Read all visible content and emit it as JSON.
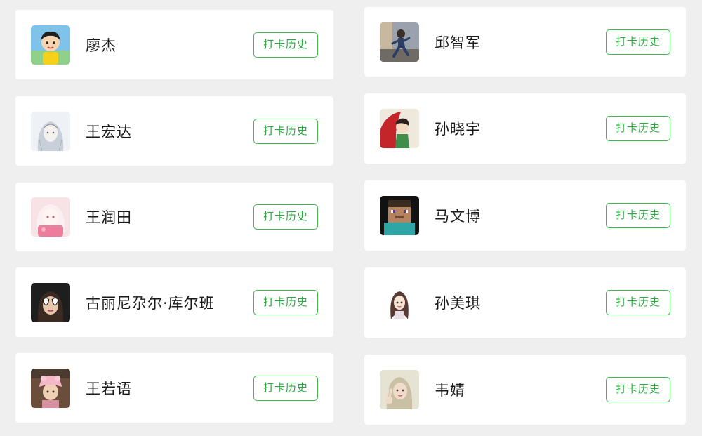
{
  "button_label": "打卡历史",
  "colors": {
    "background": "#efefef",
    "card": "#ffffff",
    "accent_border": "#3dbb4e",
    "accent_text": "#2fa844"
  },
  "members": [
    {
      "name": "廖杰",
      "avatar_icon": "cartoon-boy-avatar-icon"
    },
    {
      "name": "邱智军",
      "avatar_icon": "running-child-avatar-icon"
    },
    {
      "name": "王宏达",
      "avatar_icon": "sketch-girl-avatar-icon"
    },
    {
      "name": "孙晓宇",
      "avatar_icon": "red-umbrella-girl-avatar-icon"
    },
    {
      "name": "王润田",
      "avatar_icon": "pink-anime-girl-avatar-icon"
    },
    {
      "name": "马文博",
      "avatar_icon": "minecraft-steve-avatar-icon"
    },
    {
      "name": "古丽尼尕尔·库尔班",
      "avatar_icon": "heart-sunglasses-girl-avatar-icon"
    },
    {
      "name": "孙美琪",
      "avatar_icon": "cartoon-girl-long-hair-avatar-icon"
    },
    {
      "name": "王若语",
      "avatar_icon": "pink-hat-girl-avatar-icon"
    },
    {
      "name": "韦婧",
      "avatar_icon": "peace-sign-girl-avatar-icon"
    }
  ]
}
